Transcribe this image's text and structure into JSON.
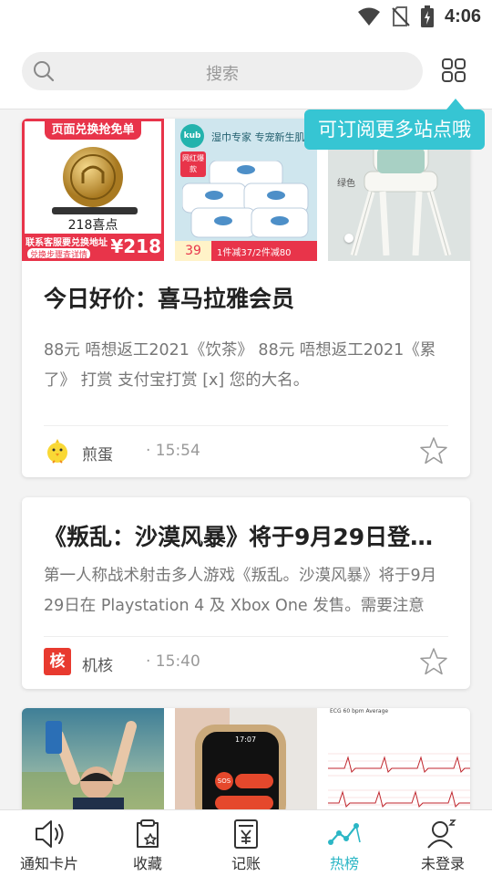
{
  "status_bar": {
    "time": "4:06"
  },
  "search": {
    "placeholder": "搜索"
  },
  "tooltip": {
    "text": "可订阅更多站点哦"
  },
  "cards": [
    {
      "thumb1": {
        "top_banner": "页面兑换抢免单",
        "price_label": "218喜点",
        "bottom_banner": "联系客服要兑换地址",
        "bottom_sub": "兑换步骤查详情",
        "price": "¥218"
      },
      "thumb2": {
        "brand": "kub",
        "headline": "湿巾专家 专宠新生肌",
        "badge": "网红爆款",
        "price": "39",
        "promo": "1件减37/2件减80"
      },
      "thumb3": {
        "label": "绿色"
      },
      "title": "今日好价：喜马拉雅会员",
      "desc": "88元 唔想返工2021《饮茶》 88元 唔想返工2021《累了》 打赏 支付宝打赏 [x] 您的大名。",
      "source": "煎蛋",
      "time": "· 15:54"
    },
    {
      "title": "《叛乱：沙漠风暴》将于9月29日登…",
      "desc": "第一人称战术射击多人游戏《叛乱。沙漠风暴》将于9月29日在 Playstation 4 及 Xbox One 发售。需要注意的…",
      "source": "机核",
      "source_icon_text": "核",
      "time": "· 15:40"
    },
    {
      "thumb2": {
        "watch_time": "17:07",
        "watch_sos": "SOS"
      },
      "thumb3": {
        "header": "ECG 60 bpm Average"
      }
    }
  ],
  "nav": [
    {
      "label": "通知卡片",
      "icon": "speaker-icon"
    },
    {
      "label": "收藏",
      "icon": "clipboard-star-icon"
    },
    {
      "label": "记账",
      "icon": "ledger-yen-icon"
    },
    {
      "label": "热榜",
      "icon": "trend-chart-icon"
    },
    {
      "label": "未登录",
      "icon": "user-sleep-icon"
    }
  ],
  "colors": {
    "accent": "#36c5d3",
    "active_nav": "#2bb6c5"
  }
}
